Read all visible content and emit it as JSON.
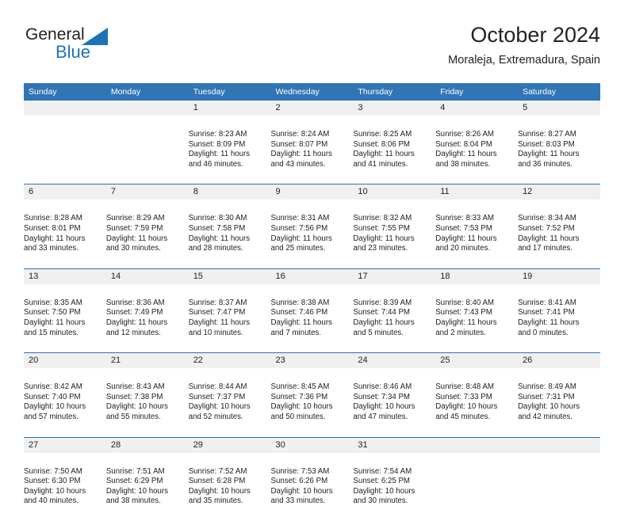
{
  "brand": {
    "name_top": "General",
    "name_bottom": "Blue",
    "accent_color": "#1d72b8"
  },
  "header": {
    "title": "October 2024",
    "location": "Moraleja, Extremadura, Spain"
  },
  "theme": {
    "header_row_color": "#3175b4",
    "row_border_color": "#2f6fad",
    "daynum_background": "#f0f0f0",
    "text_color": "#222222"
  },
  "calendar": {
    "weekday_headers": [
      "Sunday",
      "Monday",
      "Tuesday",
      "Wednesday",
      "Thursday",
      "Friday",
      "Saturday"
    ],
    "labels": {
      "sunrise_prefix": "Sunrise:",
      "sunset_prefix": "Sunset:",
      "daylight_prefix": "Daylight:"
    },
    "weeks": [
      [
        {
          "day": "",
          "sunrise": "",
          "sunset": "",
          "daylight_line1": "",
          "daylight_line2": ""
        },
        {
          "day": "",
          "sunrise": "",
          "sunset": "",
          "daylight_line1": "",
          "daylight_line2": ""
        },
        {
          "day": "1",
          "sunrise": "Sunrise: 8:23 AM",
          "sunset": "Sunset: 8:09 PM",
          "daylight_line1": "Daylight: 11 hours",
          "daylight_line2": "and 46 minutes."
        },
        {
          "day": "2",
          "sunrise": "Sunrise: 8:24 AM",
          "sunset": "Sunset: 8:07 PM",
          "daylight_line1": "Daylight: 11 hours",
          "daylight_line2": "and 43 minutes."
        },
        {
          "day": "3",
          "sunrise": "Sunrise: 8:25 AM",
          "sunset": "Sunset: 8:06 PM",
          "daylight_line1": "Daylight: 11 hours",
          "daylight_line2": "and 41 minutes."
        },
        {
          "day": "4",
          "sunrise": "Sunrise: 8:26 AM",
          "sunset": "Sunset: 8:04 PM",
          "daylight_line1": "Daylight: 11 hours",
          "daylight_line2": "and 38 minutes."
        },
        {
          "day": "5",
          "sunrise": "Sunrise: 8:27 AM",
          "sunset": "Sunset: 8:03 PM",
          "daylight_line1": "Daylight: 11 hours",
          "daylight_line2": "and 36 minutes."
        }
      ],
      [
        {
          "day": "6",
          "sunrise": "Sunrise: 8:28 AM",
          "sunset": "Sunset: 8:01 PM",
          "daylight_line1": "Daylight: 11 hours",
          "daylight_line2": "and 33 minutes."
        },
        {
          "day": "7",
          "sunrise": "Sunrise: 8:29 AM",
          "sunset": "Sunset: 7:59 PM",
          "daylight_line1": "Daylight: 11 hours",
          "daylight_line2": "and 30 minutes."
        },
        {
          "day": "8",
          "sunrise": "Sunrise: 8:30 AM",
          "sunset": "Sunset: 7:58 PM",
          "daylight_line1": "Daylight: 11 hours",
          "daylight_line2": "and 28 minutes."
        },
        {
          "day": "9",
          "sunrise": "Sunrise: 8:31 AM",
          "sunset": "Sunset: 7:56 PM",
          "daylight_line1": "Daylight: 11 hours",
          "daylight_line2": "and 25 minutes."
        },
        {
          "day": "10",
          "sunrise": "Sunrise: 8:32 AM",
          "sunset": "Sunset: 7:55 PM",
          "daylight_line1": "Daylight: 11 hours",
          "daylight_line2": "and 23 minutes."
        },
        {
          "day": "11",
          "sunrise": "Sunrise: 8:33 AM",
          "sunset": "Sunset: 7:53 PM",
          "daylight_line1": "Daylight: 11 hours",
          "daylight_line2": "and 20 minutes."
        },
        {
          "day": "12",
          "sunrise": "Sunrise: 8:34 AM",
          "sunset": "Sunset: 7:52 PM",
          "daylight_line1": "Daylight: 11 hours",
          "daylight_line2": "and 17 minutes."
        }
      ],
      [
        {
          "day": "13",
          "sunrise": "Sunrise: 8:35 AM",
          "sunset": "Sunset: 7:50 PM",
          "daylight_line1": "Daylight: 11 hours",
          "daylight_line2": "and 15 minutes."
        },
        {
          "day": "14",
          "sunrise": "Sunrise: 8:36 AM",
          "sunset": "Sunset: 7:49 PM",
          "daylight_line1": "Daylight: 11 hours",
          "daylight_line2": "and 12 minutes."
        },
        {
          "day": "15",
          "sunrise": "Sunrise: 8:37 AM",
          "sunset": "Sunset: 7:47 PM",
          "daylight_line1": "Daylight: 11 hours",
          "daylight_line2": "and 10 minutes."
        },
        {
          "day": "16",
          "sunrise": "Sunrise: 8:38 AM",
          "sunset": "Sunset: 7:46 PM",
          "daylight_line1": "Daylight: 11 hours",
          "daylight_line2": "and 7 minutes."
        },
        {
          "day": "17",
          "sunrise": "Sunrise: 8:39 AM",
          "sunset": "Sunset: 7:44 PM",
          "daylight_line1": "Daylight: 11 hours",
          "daylight_line2": "and 5 minutes."
        },
        {
          "day": "18",
          "sunrise": "Sunrise: 8:40 AM",
          "sunset": "Sunset: 7:43 PM",
          "daylight_line1": "Daylight: 11 hours",
          "daylight_line2": "and 2 minutes."
        },
        {
          "day": "19",
          "sunrise": "Sunrise: 8:41 AM",
          "sunset": "Sunset: 7:41 PM",
          "daylight_line1": "Daylight: 11 hours",
          "daylight_line2": "and 0 minutes."
        }
      ],
      [
        {
          "day": "20",
          "sunrise": "Sunrise: 8:42 AM",
          "sunset": "Sunset: 7:40 PM",
          "daylight_line1": "Daylight: 10 hours",
          "daylight_line2": "and 57 minutes."
        },
        {
          "day": "21",
          "sunrise": "Sunrise: 8:43 AM",
          "sunset": "Sunset: 7:38 PM",
          "daylight_line1": "Daylight: 10 hours",
          "daylight_line2": "and 55 minutes."
        },
        {
          "day": "22",
          "sunrise": "Sunrise: 8:44 AM",
          "sunset": "Sunset: 7:37 PM",
          "daylight_line1": "Daylight: 10 hours",
          "daylight_line2": "and 52 minutes."
        },
        {
          "day": "23",
          "sunrise": "Sunrise: 8:45 AM",
          "sunset": "Sunset: 7:36 PM",
          "daylight_line1": "Daylight: 10 hours",
          "daylight_line2": "and 50 minutes."
        },
        {
          "day": "24",
          "sunrise": "Sunrise: 8:46 AM",
          "sunset": "Sunset: 7:34 PM",
          "daylight_line1": "Daylight: 10 hours",
          "daylight_line2": "and 47 minutes."
        },
        {
          "day": "25",
          "sunrise": "Sunrise: 8:48 AM",
          "sunset": "Sunset: 7:33 PM",
          "daylight_line1": "Daylight: 10 hours",
          "daylight_line2": "and 45 minutes."
        },
        {
          "day": "26",
          "sunrise": "Sunrise: 8:49 AM",
          "sunset": "Sunset: 7:31 PM",
          "daylight_line1": "Daylight: 10 hours",
          "daylight_line2": "and 42 minutes."
        }
      ],
      [
        {
          "day": "27",
          "sunrise": "Sunrise: 7:50 AM",
          "sunset": "Sunset: 6:30 PM",
          "daylight_line1": "Daylight: 10 hours",
          "daylight_line2": "and 40 minutes."
        },
        {
          "day": "28",
          "sunrise": "Sunrise: 7:51 AM",
          "sunset": "Sunset: 6:29 PM",
          "daylight_line1": "Daylight: 10 hours",
          "daylight_line2": "and 38 minutes."
        },
        {
          "day": "29",
          "sunrise": "Sunrise: 7:52 AM",
          "sunset": "Sunset: 6:28 PM",
          "daylight_line1": "Daylight: 10 hours",
          "daylight_line2": "and 35 minutes."
        },
        {
          "day": "30",
          "sunrise": "Sunrise: 7:53 AM",
          "sunset": "Sunset: 6:26 PM",
          "daylight_line1": "Daylight: 10 hours",
          "daylight_line2": "and 33 minutes."
        },
        {
          "day": "31",
          "sunrise": "Sunrise: 7:54 AM",
          "sunset": "Sunset: 6:25 PM",
          "daylight_line1": "Daylight: 10 hours",
          "daylight_line2": "and 30 minutes."
        },
        {
          "day": "",
          "sunrise": "",
          "sunset": "",
          "daylight_line1": "",
          "daylight_line2": ""
        },
        {
          "day": "",
          "sunrise": "",
          "sunset": "",
          "daylight_line1": "",
          "daylight_line2": ""
        }
      ]
    ]
  }
}
